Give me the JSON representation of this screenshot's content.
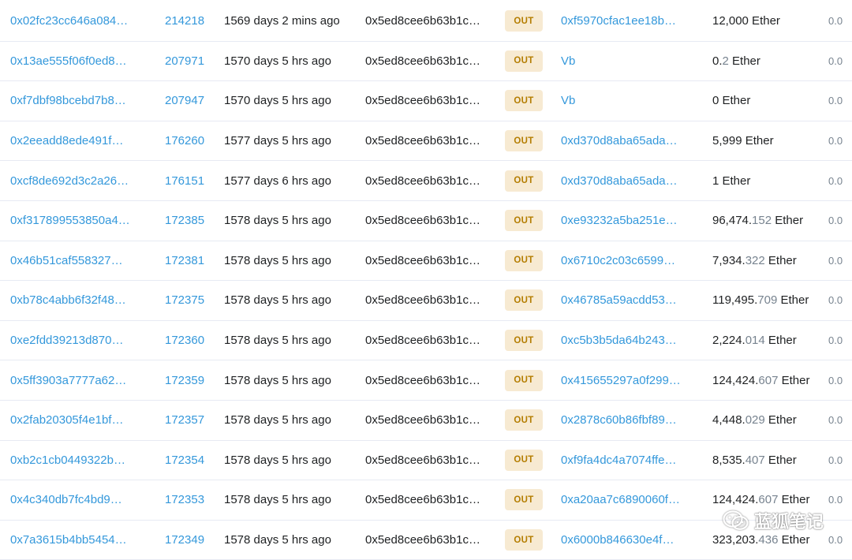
{
  "colors": {
    "link": "#3498db",
    "text": "#1e2022",
    "muted": "#77838f",
    "out_badge_bg": "#f7ead2",
    "out_badge_text": "#b47d00",
    "row_border": "#e7eaf3"
  },
  "transactions": [
    {
      "hash": "0x02fc23cc646a084…",
      "block": "214218",
      "age": "1569 days 2 mins ago",
      "from": "0x5ed8cee6b63b1c…",
      "direction": "OUT",
      "to": "0xf5970cfac1ee18b…",
      "value_main": "12,000",
      "value_frac": "",
      "value_unit": " Ether",
      "fee": "0.0"
    },
    {
      "hash": "0x13ae555f06f0ed8…",
      "block": "207971",
      "age": "1570 days 5 hrs ago",
      "from": "0x5ed8cee6b63b1c…",
      "direction": "OUT",
      "to": "Vb",
      "value_main": "0.",
      "value_frac": "2",
      "value_unit": " Ether",
      "fee": "0.0"
    },
    {
      "hash": "0xf7dbf98bcebd7b8…",
      "block": "207947",
      "age": "1570 days 5 hrs ago",
      "from": "0x5ed8cee6b63b1c…",
      "direction": "OUT",
      "to": "Vb",
      "value_main": "0",
      "value_frac": "",
      "value_unit": " Ether",
      "fee": "0.0"
    },
    {
      "hash": "0x2eeadd8ede491f…",
      "block": "176260",
      "age": "1577 days 5 hrs ago",
      "from": "0x5ed8cee6b63b1c…",
      "direction": "OUT",
      "to": "0xd370d8aba65ada…",
      "value_main": "5,999",
      "value_frac": "",
      "value_unit": " Ether",
      "fee": "0.0"
    },
    {
      "hash": "0xcf8de692d3c2a26…",
      "block": "176151",
      "age": "1577 days 6 hrs ago",
      "from": "0x5ed8cee6b63b1c…",
      "direction": "OUT",
      "to": "0xd370d8aba65ada…",
      "value_main": "1",
      "value_frac": "",
      "value_unit": " Ether",
      "fee": "0.0"
    },
    {
      "hash": "0xf317899553850a4…",
      "block": "172385",
      "age": "1578 days 5 hrs ago",
      "from": "0x5ed8cee6b63b1c…",
      "direction": "OUT",
      "to": "0xe93232a5ba251e…",
      "value_main": "96,474.",
      "value_frac": "152",
      "value_unit": " Ether",
      "fee": "0.0"
    },
    {
      "hash": "0x46b51caf558327…",
      "block": "172381",
      "age": "1578 days 5 hrs ago",
      "from": "0x5ed8cee6b63b1c…",
      "direction": "OUT",
      "to": "0x6710c2c03c6599…",
      "value_main": "7,934.",
      "value_frac": "322",
      "value_unit": " Ether",
      "fee": "0.0"
    },
    {
      "hash": "0xb78c4abb6f32f48…",
      "block": "172375",
      "age": "1578 days 5 hrs ago",
      "from": "0x5ed8cee6b63b1c…",
      "direction": "OUT",
      "to": "0x46785a59acdd53…",
      "value_main": "119,495.",
      "value_frac": "709",
      "value_unit": " Ether",
      "fee": "0.0"
    },
    {
      "hash": "0xe2fdd39213d870…",
      "block": "172360",
      "age": "1578 days 5 hrs ago",
      "from": "0x5ed8cee6b63b1c…",
      "direction": "OUT",
      "to": "0xc5b3b5da64b243…",
      "value_main": "2,224.",
      "value_frac": "014",
      "value_unit": " Ether",
      "fee": "0.0"
    },
    {
      "hash": "0x5ff3903a7777a62…",
      "block": "172359",
      "age": "1578 days 5 hrs ago",
      "from": "0x5ed8cee6b63b1c…",
      "direction": "OUT",
      "to": "0x415655297a0f299…",
      "value_main": "124,424.",
      "value_frac": "607",
      "value_unit": " Ether",
      "fee": "0.0"
    },
    {
      "hash": "0x2fab20305f4e1bf…",
      "block": "172357",
      "age": "1578 days 5 hrs ago",
      "from": "0x5ed8cee6b63b1c…",
      "direction": "OUT",
      "to": "0x2878c60b86fbf89…",
      "value_main": "4,448.",
      "value_frac": "029",
      "value_unit": " Ether",
      "fee": "0.0"
    },
    {
      "hash": "0xb2c1cb0449322b…",
      "block": "172354",
      "age": "1578 days 5 hrs ago",
      "from": "0x5ed8cee6b63b1c…",
      "direction": "OUT",
      "to": "0xf9fa4dc4a7074ffe…",
      "value_main": "8,535.",
      "value_frac": "407",
      "value_unit": " Ether",
      "fee": "0.0"
    },
    {
      "hash": "0x4c340db7fc4bd9…",
      "block": "172353",
      "age": "1578 days 5 hrs ago",
      "from": "0x5ed8cee6b63b1c…",
      "direction": "OUT",
      "to": "0xa20aa7c6890060f…",
      "value_main": "124,424.",
      "value_frac": "607",
      "value_unit": " Ether",
      "fee": "0.0"
    },
    {
      "hash": "0x7a3615b4bb5454…",
      "block": "172349",
      "age": "1578 days 5 hrs ago",
      "from": "0x5ed8cee6b63b1c…",
      "direction": "OUT",
      "to": "0x6000b846630e4f…",
      "value_main": "323,203.",
      "value_frac": "436",
      "value_unit": " Ether",
      "fee": "0.0"
    }
  ],
  "watermark": {
    "text": "蓝狐笔记",
    "icon": "wechat-icon"
  }
}
